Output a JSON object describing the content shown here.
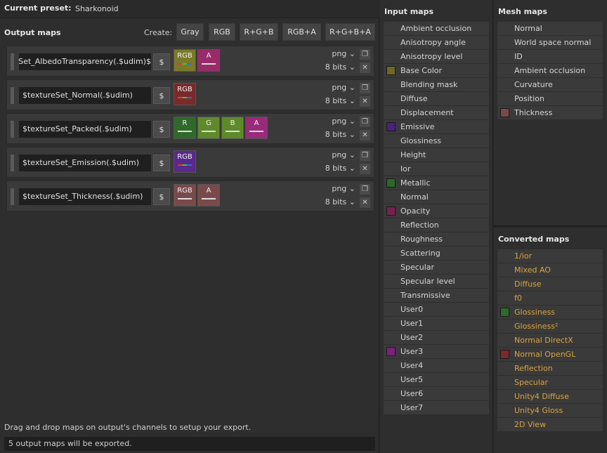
{
  "preset": {
    "label": "Current preset:",
    "value": "Sharkonoid"
  },
  "output": {
    "title": "Output maps",
    "create_label": "Create:",
    "create_buttons": [
      "Gray",
      "RGB",
      "R+G+B",
      "RGB+A",
      "R+G+B+A"
    ],
    "rows": [
      {
        "name": "$textureSet_AlbedoTransparency(.$udim)",
        "format": "png",
        "bits": "8 bits",
        "channels": [
          {
            "label": "RGB",
            "color": "#7a7a2a",
            "line": "rgb"
          },
          {
            "label": "A",
            "color": "#9a2a6a",
            "line": "white"
          }
        ]
      },
      {
        "name": "$textureSet_Normal(.$udim)",
        "format": "png",
        "bits": "8 bits",
        "channels": [
          {
            "label": "RGB",
            "color": "#7a2a2a",
            "line": "rgb"
          }
        ]
      },
      {
        "name": "$textureSet_Packed(.$udim)",
        "format": "png",
        "bits": "8 bits",
        "channels": [
          {
            "label": "R",
            "color": "#2f6a2a",
            "line": "white"
          },
          {
            "label": "G",
            "color": "#5f8a2a",
            "line": "white"
          },
          {
            "label": "B",
            "color": "#5f8a2a",
            "line": "white"
          },
          {
            "label": "A",
            "color": "#9a2a7a",
            "line": "white"
          }
        ]
      },
      {
        "name": "$textureSet_Emission(.$udim)",
        "format": "png",
        "bits": "8 bits",
        "channels": [
          {
            "label": "RGB",
            "color": "#5a2a8a",
            "line": "rgb"
          }
        ]
      },
      {
        "name": "$textureSet_Thickness(.$udim)",
        "format": "png",
        "bits": "8 bits",
        "channels": [
          {
            "label": "RGB",
            "color": "#7a4a4a",
            "line": "white"
          },
          {
            "label": "A",
            "color": "#7a4a4a",
            "line": "white"
          }
        ]
      }
    ],
    "dollar": "$",
    "hint": "Drag and drop maps on output's channels to setup your export.",
    "status": "5 output maps will be exported."
  },
  "input_maps": {
    "title": "Input maps",
    "items": [
      {
        "label": "Ambient occlusion"
      },
      {
        "label": "Anisotropy angle"
      },
      {
        "label": "Anisotropy level"
      },
      {
        "label": "Base Color",
        "swatch": "#6e6a1f"
      },
      {
        "label": "Blending mask"
      },
      {
        "label": "Diffuse"
      },
      {
        "label": "Displacement"
      },
      {
        "label": "Emissive",
        "swatch": "#4a2080"
      },
      {
        "label": "Glossiness"
      },
      {
        "label": "Height"
      },
      {
        "label": "Ior"
      },
      {
        "label": "Metallic",
        "swatch": "#2a6a2a"
      },
      {
        "label": "Normal"
      },
      {
        "label": "Opacity",
        "swatch": "#7a2050"
      },
      {
        "label": "Reflection"
      },
      {
        "label": "Roughness"
      },
      {
        "label": "Scattering"
      },
      {
        "label": "Specular"
      },
      {
        "label": "Specular level"
      },
      {
        "label": "Transmissive"
      },
      {
        "label": "User0"
      },
      {
        "label": "User1"
      },
      {
        "label": "User2"
      },
      {
        "label": "User3",
        "swatch": "#7a2080"
      },
      {
        "label": "User4"
      },
      {
        "label": "User5"
      },
      {
        "label": "User6"
      },
      {
        "label": "User7"
      }
    ]
  },
  "mesh_maps": {
    "title": "Mesh maps",
    "items": [
      {
        "label": "Normal"
      },
      {
        "label": "World space normal"
      },
      {
        "label": "ID"
      },
      {
        "label": "Ambient occlusion"
      },
      {
        "label": "Curvature"
      },
      {
        "label": "Position"
      },
      {
        "label": "Thickness",
        "swatch": "#7a4a4a"
      }
    ]
  },
  "converted_maps": {
    "title": "Converted maps",
    "items": [
      {
        "label": "1/ior"
      },
      {
        "label": "Mixed AO"
      },
      {
        "label": "Diffuse"
      },
      {
        "label": "f0"
      },
      {
        "label": "Glossiness",
        "swatch": "#2f6a2a"
      },
      {
        "label": "Glossiness²"
      },
      {
        "label": "Normal DirectX"
      },
      {
        "label": "Normal OpenGL",
        "swatch": "#7a2a2a"
      },
      {
        "label": "Reflection"
      },
      {
        "label": "Specular"
      },
      {
        "label": "Unity4 Diffuse"
      },
      {
        "label": "Unity4 Gloss"
      },
      {
        "label": "2D View"
      }
    ]
  },
  "icons": {
    "copy": "copy-icon",
    "delete": "close-icon",
    "dropdown": "chevron-down-icon"
  }
}
